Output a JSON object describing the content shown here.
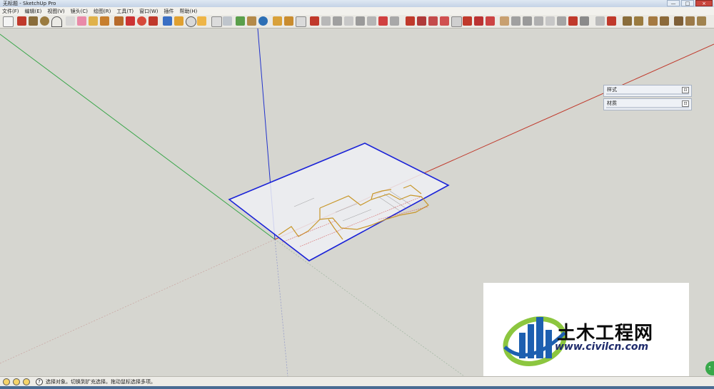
{
  "window": {
    "title": "无标题 - SketchUp Pro",
    "minimize": "—",
    "maximize": "□",
    "close": "×"
  },
  "menubar": {
    "items": [
      "文件(F)",
      "编辑(E)",
      "视图(V)",
      "镜头(C)",
      "绘图(R)",
      "工具(T)",
      "窗口(W)",
      "插件",
      "帮助(H)"
    ]
  },
  "trays": [
    {
      "label": "样式",
      "pin": "⊡"
    },
    {
      "label": "材质",
      "pin": "⊡"
    }
  ],
  "statusbar": {
    "help_icon": "?",
    "message": "选择对象。切换到扩充选择。拖动鼠标选择多项。"
  },
  "watermark": {
    "name": "土木工程网",
    "url": "www.civilcn.com"
  },
  "colors": {
    "axis_red": "#c0392b",
    "axis_green": "#3aa64a",
    "axis_blue": "#2233cc",
    "selection": "#1a22d8",
    "background": "#d6d6d0"
  }
}
